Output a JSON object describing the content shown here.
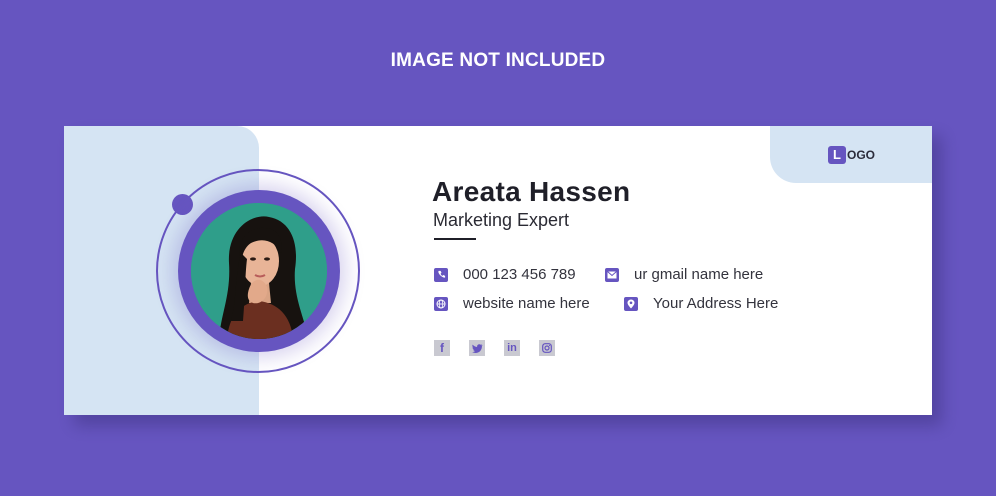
{
  "header": {
    "text": "IMAGE NOT INCLUDED"
  },
  "logo": {
    "letter": "L",
    "text": "OGO"
  },
  "person": {
    "name": "Areata Hassen",
    "title": "Marketing Expert"
  },
  "contacts": [
    {
      "icon": "phone-icon",
      "text": "000 123 456 789"
    },
    {
      "icon": "email-icon",
      "text": "ur gmail name here"
    },
    {
      "icon": "globe-icon",
      "text": "website name here"
    },
    {
      "icon": "location-pin-icon",
      "text": "Your Address Here"
    }
  ],
  "social": [
    {
      "icon": "facebook-icon",
      "glyph": "f"
    },
    {
      "icon": "twitter-icon",
      "glyph": ""
    },
    {
      "icon": "linkedin-icon",
      "glyph": "in"
    },
    {
      "icon": "instagram-icon",
      "glyph": ""
    }
  ],
  "colors": {
    "background": "#6655c0",
    "accent": "#6655c0",
    "panel": "#d5e4f3",
    "card": "#ffffff"
  }
}
